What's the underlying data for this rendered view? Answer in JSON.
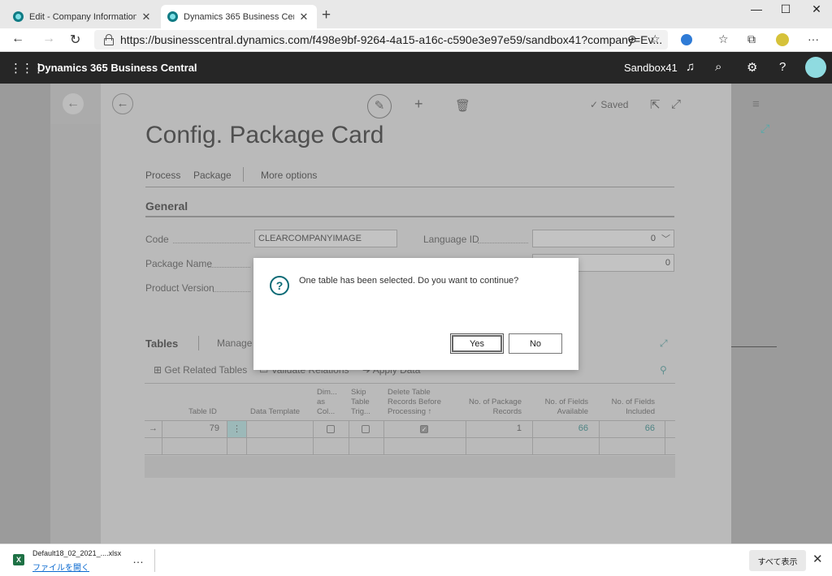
{
  "browser": {
    "tabs": [
      {
        "title": "Edit - Company Information - Dy",
        "close": "✕"
      },
      {
        "title": "Dynamics 365 Business Central -",
        "close": "✕"
      }
    ],
    "new_tab": "+",
    "window_controls": [
      "—",
      "☐",
      "✕"
    ],
    "nav": {
      "back": "←",
      "forward": "→",
      "reload": "↻"
    },
    "url": "https://businesscentral.dynamics.com/f498e9bf-9264-4a15-a16c-c590e3e97e59/sandbox41?company=Ev...",
    "toolbar_icons": [
      "add-site-icon",
      "favorite-icon",
      "edge-icon",
      "collections-icon",
      "extensions-icon",
      "profile-icon",
      "more-icon"
    ]
  },
  "app": {
    "name": "Dynamics 365 Business Central",
    "environment": "Sandbox41",
    "icons": [
      "bell-icon",
      "search-icon",
      "gear-icon",
      "help-icon",
      "avatar"
    ]
  },
  "card": {
    "title": "Config. Package Card",
    "saved_label": "Saved",
    "menu": [
      "Process",
      "Package",
      "More options"
    ],
    "section_title": "General",
    "fields": {
      "code_label": "Code",
      "code_value": "CLEARCOMPANYIMAGE",
      "package_name_label": "Package Name",
      "product_version_label": "Product Version",
      "language_id_label": "Language ID",
      "language_id_value": "0",
      "second_value": "0"
    },
    "tables": {
      "title": "Tables",
      "manage": "Manage",
      "actions": [
        "Get Related Tables",
        "Validate Relations",
        "Apply Data"
      ],
      "columns": [
        "Table ID",
        "Data Template",
        "Dim... as Col...",
        "Skip Table Trig...",
        "Delete Table Records Before Processing ↑",
        "No. of Package Records",
        "No. of Fields Available",
        "No. of Fields Included"
      ],
      "row": {
        "arrow": "→",
        "table_id": "79",
        "menu": "⋮",
        "delete_checked": true,
        "package_records": "1",
        "fields_available": "66",
        "fields_included": "66"
      }
    }
  },
  "dialog": {
    "message": "One table has been selected. Do you want to continue?",
    "yes": "Yes",
    "no": "No",
    "icon": "?"
  },
  "download": {
    "filename": "Default18_02_2021_....xlsx",
    "open_label": "ファイルを開く",
    "more": "…",
    "show_all": "すべて表示",
    "close": "✕"
  }
}
